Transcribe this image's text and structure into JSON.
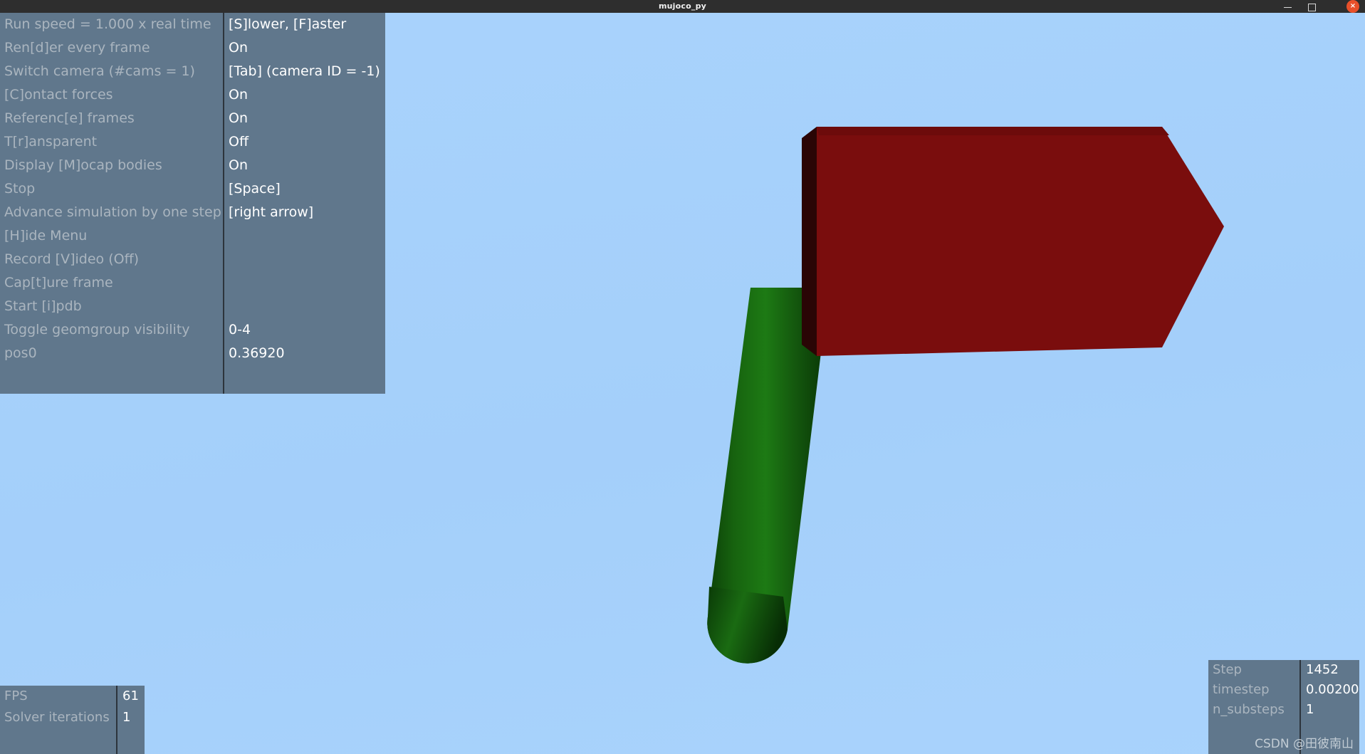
{
  "window": {
    "title": "mujoco_py",
    "minimize_label": "",
    "maximize_label": "",
    "close_label": "×"
  },
  "menu": {
    "rows": [
      {
        "key": "Run speed = 1.000 x real time",
        "value": "[S]lower, [F]aster"
      },
      {
        "key": "Ren[d]er every frame",
        "value": "On"
      },
      {
        "key": "Switch camera (#cams = 1)",
        "value": "[Tab] (camera ID = -1)"
      },
      {
        "key": "[C]ontact forces",
        "value": "On"
      },
      {
        "key": "Referenc[e] frames",
        "value": "On"
      },
      {
        "key": "T[r]ansparent",
        "value": "Off"
      },
      {
        "key": "Display [M]ocap bodies",
        "value": "On"
      },
      {
        "key": "Stop",
        "value": "[Space]"
      },
      {
        "key": "Advance simulation by one step",
        "value": "[right arrow]"
      },
      {
        "key": "[H]ide Menu",
        "value": ""
      },
      {
        "key": "Record [V]ideo (Off)",
        "value": ""
      },
      {
        "key": "Cap[t]ure frame",
        "value": ""
      },
      {
        "key": "Start [i]pdb",
        "value": ""
      },
      {
        "key": "Toggle geomgroup visibility",
        "value": "0-4"
      },
      {
        "key": "pos0",
        "value": "0.36920"
      }
    ]
  },
  "fps_panel": {
    "rows": [
      {
        "key": "FPS",
        "value": "61"
      },
      {
        "key": "Solver iterations",
        "value": "1"
      }
    ]
  },
  "step_panel": {
    "rows": [
      {
        "key": "Step",
        "value": "1452"
      },
      {
        "key": "timestep",
        "value": "0.00200"
      },
      {
        "key": "n_substeps",
        "value": "1"
      }
    ],
    "watermark": "CSDN @田彼南山"
  },
  "scene": {
    "background_color": "#a6d1fb",
    "objects": [
      {
        "name": "hammer-head",
        "shape": "box",
        "color": "#7a0d0d",
        "shade_color": "#2a0505"
      },
      {
        "name": "hammer-handle",
        "shape": "capsule",
        "color": "#1a6b12",
        "shade_color": "#0b3a07"
      }
    ]
  }
}
